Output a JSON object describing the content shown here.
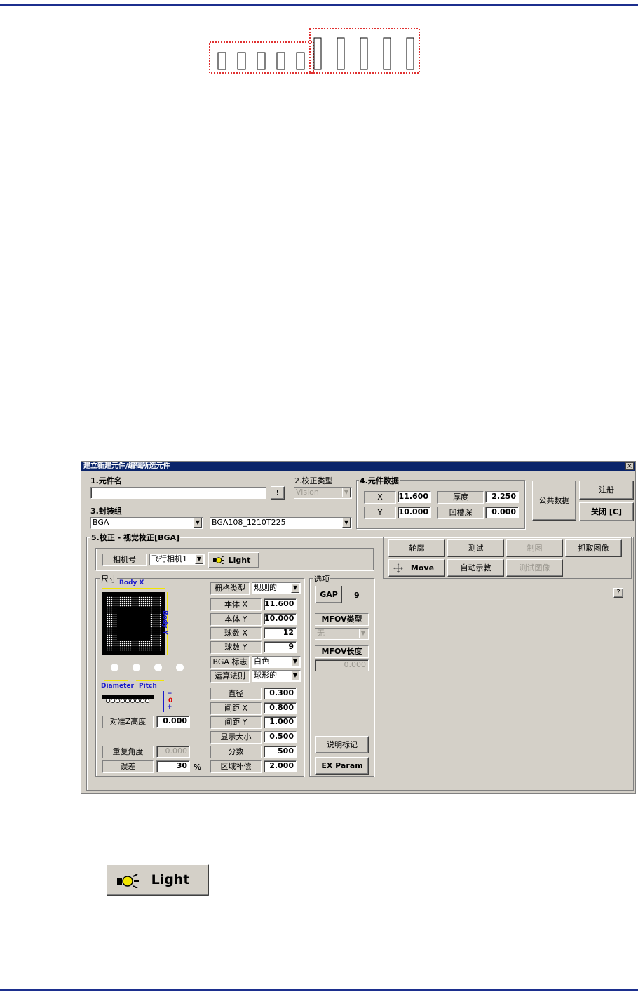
{
  "dialog": {
    "title": "建立新建元件/编辑所选元件",
    "close_glyph": "×",
    "sec1_label": "1.元件名",
    "part_name_value": "",
    "bang_button": "!",
    "sec2_label": "2.校正类型",
    "correction_type": "Vision",
    "sec3_label": "3.封装组",
    "package_group": "BGA",
    "package_name": "BGA108_1210T225",
    "sec4_label": "4.元件数据",
    "x_label": "X",
    "x_value": "11.600",
    "y_label": "Y",
    "y_value": "10.000",
    "thickness_label": "厚度",
    "thickness_value": "2.250",
    "recess_label": "凹槽深",
    "recess_value": "0.000",
    "common_data_button": "公共数据",
    "register_button": "注册",
    "close_button": "关闭 [C]",
    "sec5_label": "5.校正 - 视觉校正[BGA]",
    "camera_label": "相机号",
    "camera_value": "飞行相机1",
    "light_button": "Light",
    "size_group": "尺寸",
    "body_x_label": "Body X",
    "body_y_label": "Body Y",
    "diameter_label": "Diameter",
    "pitch_label": "Pitch",
    "z_minus": "−",
    "z_zero": "0",
    "z_plus": "+",
    "align_z_label": "对准Z高度",
    "align_z_value": "0.000",
    "repeat_angle_label": "重复角度",
    "repeat_angle_value": "0.000",
    "error_label": "误差",
    "error_value": "30",
    "error_unit": "%",
    "grid_type_label": "栅格类型",
    "grid_type_value": "规则的",
    "body_x_field_label": "本体 X",
    "body_x_field_value": "11.600",
    "body_y_field_label": "本体 Y",
    "body_y_field_value": "10.000",
    "balls_x_label": "球数 X",
    "balls_x_value": "12",
    "balls_y_label": "球数 Y",
    "balls_y_value": "9",
    "bga_mark_label": "BGA 标志",
    "bga_mark_value": "白色",
    "algorithm_label": "运算法则",
    "algorithm_value": "球形的",
    "diameter_field_label": "直径",
    "diameter_field_value": "0.300",
    "pitch_x_label": "间距 X",
    "pitch_x_value": "0.800",
    "pitch_y_label": "间距 Y",
    "pitch_y_value": "1.000",
    "display_size_label": "显示大小",
    "display_size_value": "0.500",
    "score_label": "分数",
    "score_value": "500",
    "area_comp_label": "区域补偿",
    "area_comp_value": "2.000",
    "options_group": "选项",
    "gap_button": "GAP",
    "gap_value": "9",
    "mfov_type_label": "MFOV类型",
    "mfov_type_value": "无",
    "mfov_length_label": "MFOV长度",
    "mfov_length_value": "0.000",
    "note_mark_button": "说明标记",
    "ex_param_button": "EX Param",
    "outline_button": "轮廓",
    "test_button": "测试",
    "draw_button": "制图",
    "capture_button": "抓取图像",
    "move_button": "Move",
    "auto_teach_button": "自动示教",
    "test_image_button": "测试图像",
    "help_button": "?"
  },
  "light_callout": {
    "label": "Light"
  },
  "colors": {
    "rule": "#1c2f8e",
    "titlebar": "#0a246a",
    "dialog_bg": "#d4d0c8",
    "dashed_box": "#e03030",
    "label_blue": "#1a1acc",
    "lamp_yellow": "#f2e600"
  }
}
